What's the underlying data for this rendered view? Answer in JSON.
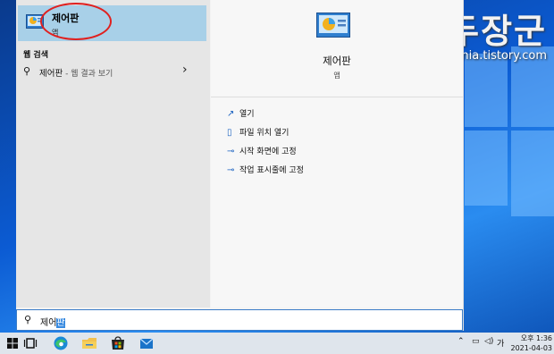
{
  "watermark": {
    "brand": "녹두장군",
    "url": "http://mainia.tistory.com"
  },
  "best_match": {
    "title": "제어판",
    "subtitle": "앱"
  },
  "web_section": {
    "label": "웹 검색",
    "query": "제어판",
    "hint": " - 웹 결과 보기"
  },
  "detail": {
    "title": "제어판",
    "subtitle": "앱"
  },
  "actions": [
    {
      "label": "열기"
    },
    {
      "label": "파일 위치 열기"
    },
    {
      "label": "시작 화면에 고정"
    },
    {
      "label": "작업 표시줄에 고정"
    }
  ],
  "search": {
    "typed": "제어",
    "selected": "판"
  },
  "taskbar": {
    "ime": "가",
    "time": "오후 1:36",
    "date": "2021-04-03"
  }
}
